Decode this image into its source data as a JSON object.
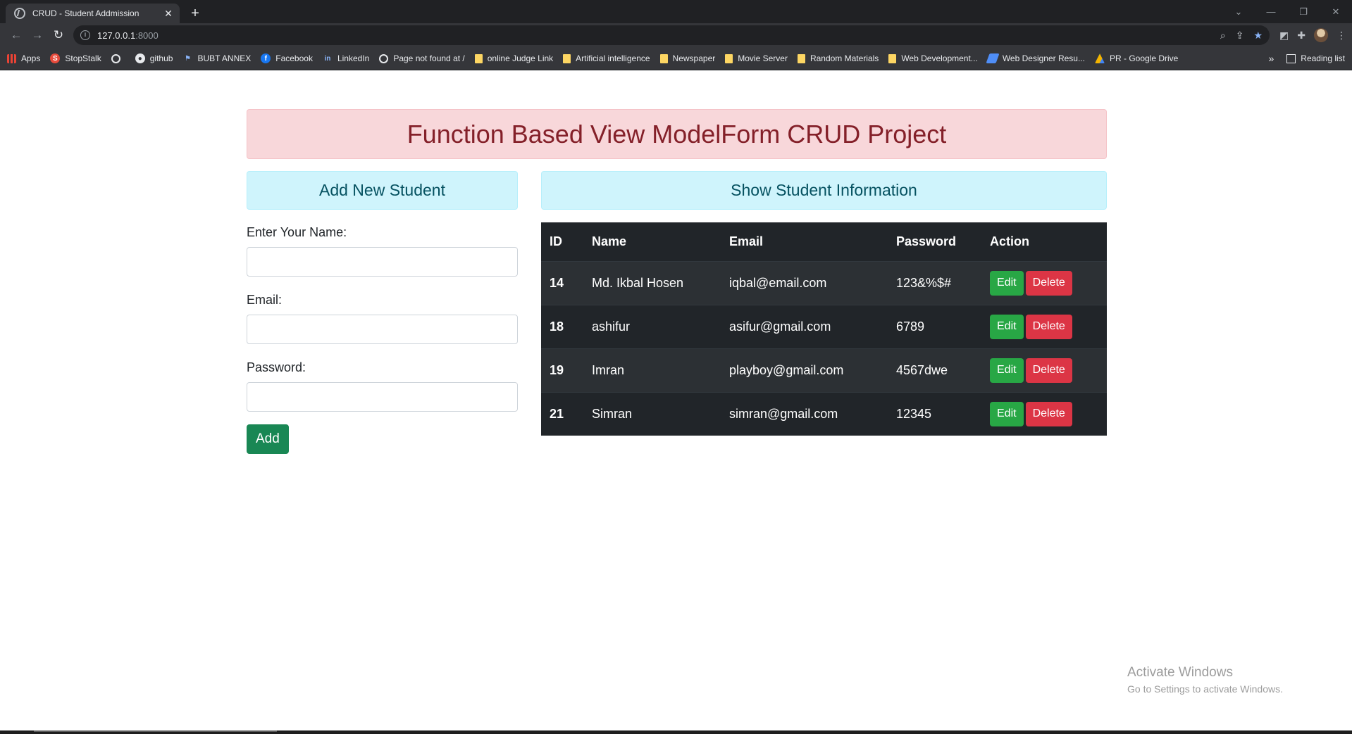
{
  "browser": {
    "tab_title": "CRUD - Student Addmission",
    "url_host": "127.0.0.1",
    "url_port": ":8000",
    "bookmarks": [
      {
        "label": "Apps",
        "icon": "apps-grid-icon"
      },
      {
        "label": "StopStalk",
        "icon": "stopstalk-icon"
      },
      {
        "label": "",
        "icon": "globe-icon"
      },
      {
        "label": "github",
        "icon": "github-icon"
      },
      {
        "label": "BUBT ANNEX",
        "icon": "bubt-icon"
      },
      {
        "label": "Facebook",
        "icon": "facebook-icon"
      },
      {
        "label": "LinkedIn",
        "icon": "linkedin-icon"
      },
      {
        "label": "Page not found at /",
        "icon": "globe-icon"
      },
      {
        "label": "online Judge Link",
        "icon": "folder-icon"
      },
      {
        "label": "Artificial intelligence",
        "icon": "folder-icon"
      },
      {
        "label": "Newspaper",
        "icon": "folder-icon"
      },
      {
        "label": "Movie Server",
        "icon": "folder-icon"
      },
      {
        "label": "Random Materials",
        "icon": "folder-icon"
      },
      {
        "label": "Web Development...",
        "icon": "folder-icon"
      },
      {
        "label": "Web Designer Resu...",
        "icon": "web-designer-icon"
      },
      {
        "label": "PR - Google Drive",
        "icon": "google-drive-icon"
      }
    ],
    "more": "»",
    "reading_list": "Reading list"
  },
  "page": {
    "title": "Function Based View ModelForm CRUD Project",
    "form": {
      "heading": "Add New Student",
      "name_label": "Enter Your Name:",
      "email_label": "Email:",
      "password_label": "Password:",
      "name_value": "",
      "email_value": "",
      "password_value": "",
      "submit_label": "Add"
    },
    "table": {
      "heading": "Show Student Information",
      "columns": [
        "ID",
        "Name",
        "Email",
        "Password",
        "Action"
      ],
      "edit_label": "Edit",
      "delete_label": "Delete",
      "rows": [
        {
          "id": "14",
          "name": "Md. Ikbal Hosen",
          "email": "iqbal@email.com",
          "password": "123&%$#"
        },
        {
          "id": "18",
          "name": "ashifur",
          "email": "asifur@gmail.com",
          "password": "6789"
        },
        {
          "id": "19",
          "name": "Imran",
          "email": "playboy@gmail.com",
          "password": "4567dwe"
        },
        {
          "id": "21",
          "name": "Simran",
          "email": "simran@gmail.com",
          "password": "12345"
        }
      ]
    }
  },
  "watermark": {
    "line1": "Activate Windows",
    "line2": "Go to Settings to activate Windows."
  },
  "colors": {
    "danger_bg": "#f8d7da",
    "info_bg": "#cff4fc",
    "success": "#198754",
    "danger": "#dc3545",
    "table_dark": "#212529"
  }
}
